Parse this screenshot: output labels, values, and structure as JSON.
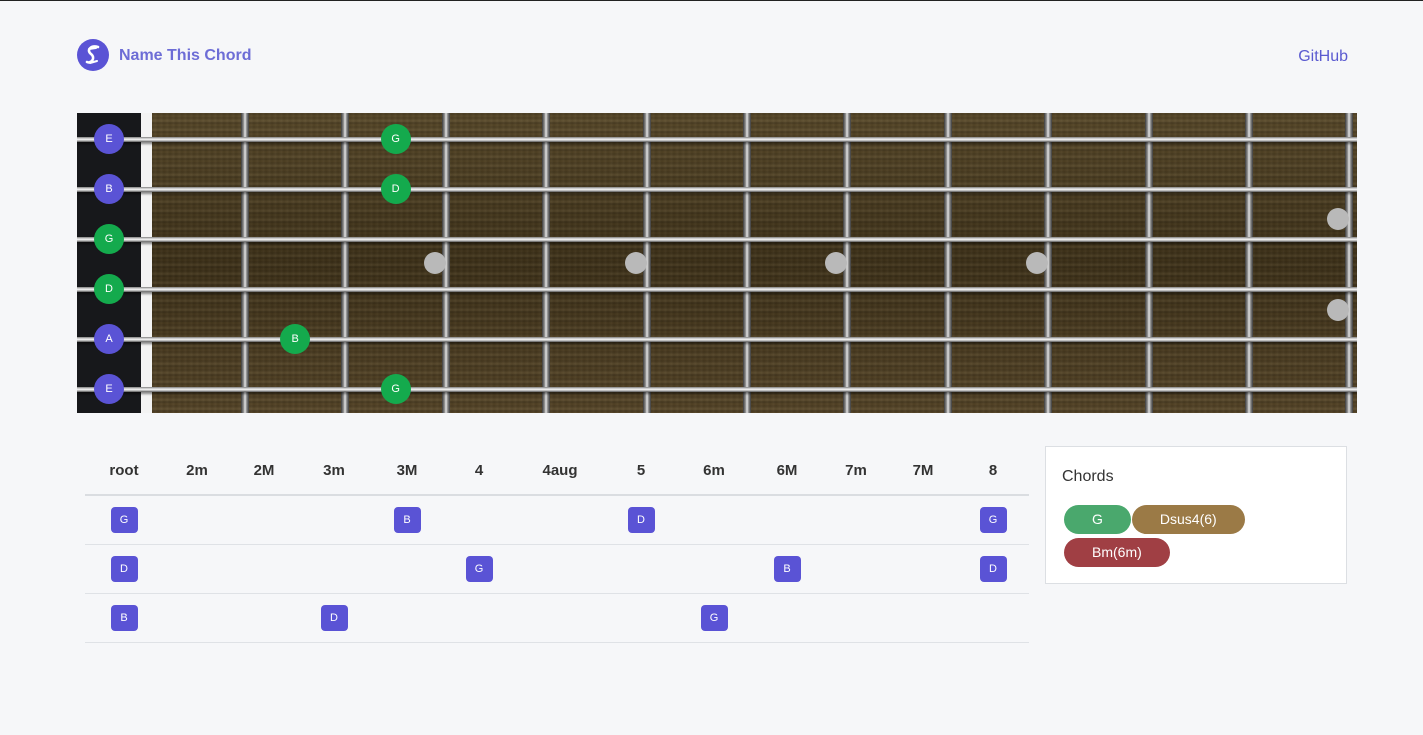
{
  "header": {
    "brand": "Name This Chord",
    "github_label": "GitHub"
  },
  "colors": {
    "accent": "#5a53d5",
    "note_green": "#14aa4d",
    "chord_g": "#4aa86d",
    "chord_dsus": "#9b7a46",
    "chord_bm": "#a03f44"
  },
  "fretboard": {
    "open_notes": [
      {
        "label": "E",
        "color": "blue"
      },
      {
        "label": "B",
        "color": "blue"
      },
      {
        "label": "G",
        "color": "green"
      },
      {
        "label": "D",
        "color": "green"
      },
      {
        "label": "A",
        "color": "blue"
      },
      {
        "label": "E",
        "color": "blue"
      }
    ],
    "fretted_notes": [
      {
        "string": 1,
        "fret": 3,
        "label": "G"
      },
      {
        "string": 2,
        "fret": 3,
        "label": "D"
      },
      {
        "string": 5,
        "fret": 2,
        "label": "B"
      },
      {
        "string": 6,
        "fret": 3,
        "label": "G"
      }
    ]
  },
  "intervals": {
    "headers": [
      "root",
      "2m",
      "2M",
      "3m",
      "3M",
      "4",
      "4aug",
      "5",
      "6m",
      "6M",
      "7m",
      "7M",
      "8"
    ],
    "rows": [
      [
        "G",
        "",
        "",
        "",
        "B",
        "",
        "",
        "D",
        "",
        "",
        "",
        "",
        "G"
      ],
      [
        "D",
        "",
        "",
        "",
        "",
        "G",
        "",
        "",
        "",
        "B",
        "",
        "",
        "D"
      ],
      [
        "B",
        "",
        "",
        "D",
        "",
        "",
        "",
        "",
        "G",
        "",
        "",
        "",
        ""
      ]
    ]
  },
  "chords": {
    "title": "Chords",
    "items": [
      {
        "label": "G",
        "color": "#4aa86d"
      },
      {
        "label": "Dsus4(6)",
        "color": "#9b7a46"
      },
      {
        "label": "Bm(6m)",
        "color": "#a03f44"
      }
    ]
  }
}
